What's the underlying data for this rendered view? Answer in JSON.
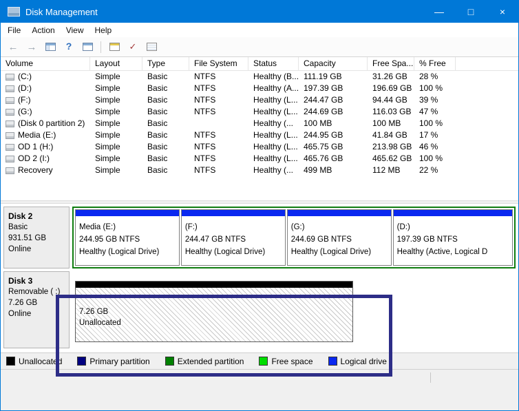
{
  "window": {
    "title": "Disk Management",
    "controls": {
      "minimize": "—",
      "maximize": "□",
      "close": "×"
    }
  },
  "menu": {
    "items": [
      "File",
      "Action",
      "View",
      "Help"
    ]
  },
  "toolbar": {
    "icons": [
      "back-icon",
      "forward-icon",
      "console-tree-icon",
      "help-icon",
      "show-hide-pane-icon",
      "export-list-icon",
      "check-icon",
      "properties-list-icon"
    ]
  },
  "table": {
    "columns": [
      "Volume",
      "Layout",
      "Type",
      "File System",
      "Status",
      "Capacity",
      "Free Spa...",
      "% Free"
    ],
    "rows": [
      {
        "volume": "(C:)",
        "layout": "Simple",
        "type": "Basic",
        "file_system": "NTFS",
        "status": "Healthy (B...",
        "capacity": "111.19 GB",
        "free_space": "31.26 GB",
        "pct_free": "28 %"
      },
      {
        "volume": "(D:)",
        "layout": "Simple",
        "type": "Basic",
        "file_system": "NTFS",
        "status": "Healthy (A...",
        "capacity": "197.39 GB",
        "free_space": "196.69 GB",
        "pct_free": "100 %"
      },
      {
        "volume": "(F:)",
        "layout": "Simple",
        "type": "Basic",
        "file_system": "NTFS",
        "status": "Healthy (L...",
        "capacity": "244.47 GB",
        "free_space": "94.44 GB",
        "pct_free": "39 %"
      },
      {
        "volume": "(G:)",
        "layout": "Simple",
        "type": "Basic",
        "file_system": "NTFS",
        "status": "Healthy (L...",
        "capacity": "244.69 GB",
        "free_space": "116.03 GB",
        "pct_free": "47 %"
      },
      {
        "volume": "(Disk 0 partition 2)",
        "layout": "Simple",
        "type": "Basic",
        "file_system": "",
        "status": "Healthy (...",
        "capacity": "100 MB",
        "free_space": "100 MB",
        "pct_free": "100 %"
      },
      {
        "volume": "Media (E:)",
        "layout": "Simple",
        "type": "Basic",
        "file_system": "NTFS",
        "status": "Healthy (L...",
        "capacity": "244.95 GB",
        "free_space": "41.84 GB",
        "pct_free": "17 %"
      },
      {
        "volume": "OD 1 (H:)",
        "layout": "Simple",
        "type": "Basic",
        "file_system": "NTFS",
        "status": "Healthy (L...",
        "capacity": "465.75 GB",
        "free_space": "213.98 GB",
        "pct_free": "46 %"
      },
      {
        "volume": "OD 2 (I:)",
        "layout": "Simple",
        "type": "Basic",
        "file_system": "NTFS",
        "status": "Healthy (L...",
        "capacity": "465.76 GB",
        "free_space": "465.62 GB",
        "pct_free": "100 %"
      },
      {
        "volume": "Recovery",
        "layout": "Simple",
        "type": "Basic",
        "file_system": "NTFS",
        "status": "Healthy (...",
        "capacity": "499 MB",
        "free_space": "112 MB",
        "pct_free": "22 %"
      }
    ]
  },
  "disks": [
    {
      "name": "Disk 2",
      "type": "Basic",
      "size": "931.51 GB",
      "status": "Online",
      "partitions": [
        {
          "name": "Media (E:)",
          "size": "244.95 GB NTFS",
          "status": "Healthy (Logical Drive)"
        },
        {
          "name": "(F:)",
          "size": "244.47 GB NTFS",
          "status": "Healthy (Logical Drive)"
        },
        {
          "name": "(G:)",
          "size": "244.69 GB NTFS",
          "status": "Healthy (Logical Drive)"
        },
        {
          "name": "(D:)",
          "size": "197.39 GB NTFS",
          "status": "Healthy (Active, Logical D"
        }
      ]
    },
    {
      "name": "Disk 3",
      "type": "Removable ( :)",
      "size": "7.26 GB",
      "status": "Online",
      "unallocated": {
        "size": "7.26 GB",
        "label": "Unallocated"
      }
    }
  ],
  "legend": [
    {
      "label": "Unallocated",
      "color": "#000000"
    },
    {
      "label": "Primary partition",
      "color": "#000080"
    },
    {
      "label": "Extended partition",
      "color": "#008000"
    },
    {
      "label": "Free space",
      "color": "#00dd00"
    },
    {
      "label": "Logical drive",
      "color": "#0a28f0"
    }
  ],
  "colors": {
    "titlebar": "#0078d7",
    "logical_drive_header": "#0a28f0",
    "unallocated_header": "#000000",
    "extended_border": "#0e7c0e",
    "annotation": "#2d2d87"
  }
}
